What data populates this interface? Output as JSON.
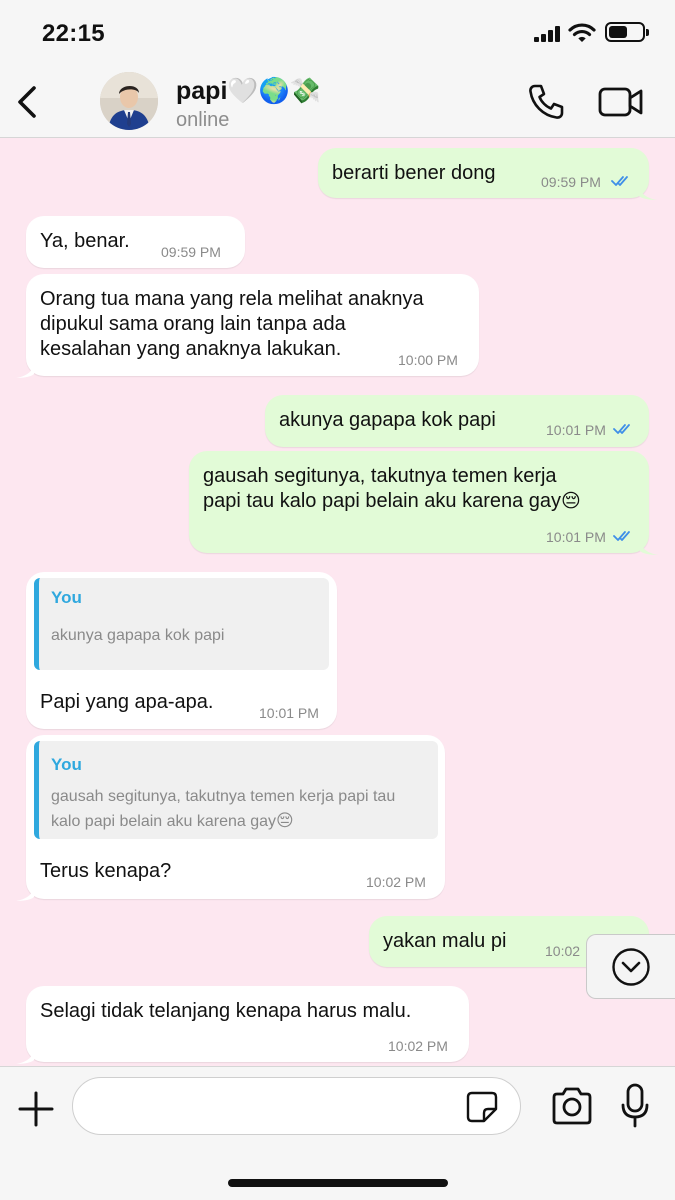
{
  "status_bar": {
    "time": "22:15"
  },
  "header": {
    "contact_name": "papi🤍🌍💸",
    "contact_status": "online",
    "icons": [
      "back-chevron-icon",
      "phone-icon",
      "video-camera-icon"
    ]
  },
  "messages": [
    {
      "direction": "out",
      "text": "berarti bener dong",
      "time": "09:59 PM",
      "read": true
    },
    {
      "direction": "in",
      "text": "Ya, benar.",
      "time": "09:59 PM"
    },
    {
      "direction": "in",
      "lines": [
        "Orang tua mana yang rela melihat anaknya",
        "dipukul sama orang lain tanpa ada",
        "kesalahan yang anaknya lakukan."
      ],
      "time": "10:00 PM"
    },
    {
      "direction": "out",
      "text": "akunya gapapa kok papi",
      "time": "10:01 PM",
      "read": true
    },
    {
      "direction": "out",
      "lines": [
        "gausah segitunya, takutnya temen kerja",
        "papi tau kalo papi belain aku karena gay"
      ],
      "emoji": "😔",
      "time": "10:01 PM",
      "read": true
    },
    {
      "direction": "in",
      "quote": {
        "author": "You",
        "lines": [
          "akunya gapapa kok papi"
        ]
      },
      "text": "Papi yang apa-apa.",
      "time": "10:01 PM"
    },
    {
      "direction": "in",
      "quote": {
        "author": "You",
        "lines": [
          "gausah segitunya, takutnya temen kerja papi tau",
          "kalo papi belain aku karena gay"
        ],
        "emoji": "😔"
      },
      "text": "Terus kenapa?",
      "time": "10:02 PM"
    },
    {
      "direction": "out",
      "text": "yakan malu pi",
      "time": "10:02"
    },
    {
      "direction": "in",
      "text": "Selagi tidak telanjang kenapa harus malu.",
      "time": "10:02 PM"
    }
  ],
  "input_bar": {
    "placeholder": "",
    "icons": [
      "plus-icon",
      "sticker-icon",
      "camera-icon",
      "microphone-icon"
    ]
  },
  "colors": {
    "chat_background": "#fde7f0",
    "outgoing_bubble": "#e2fbd7",
    "incoming_bubble": "#ffffff",
    "read_ticks": "#3f8fe8",
    "quote_accent": "#2fa8de"
  }
}
